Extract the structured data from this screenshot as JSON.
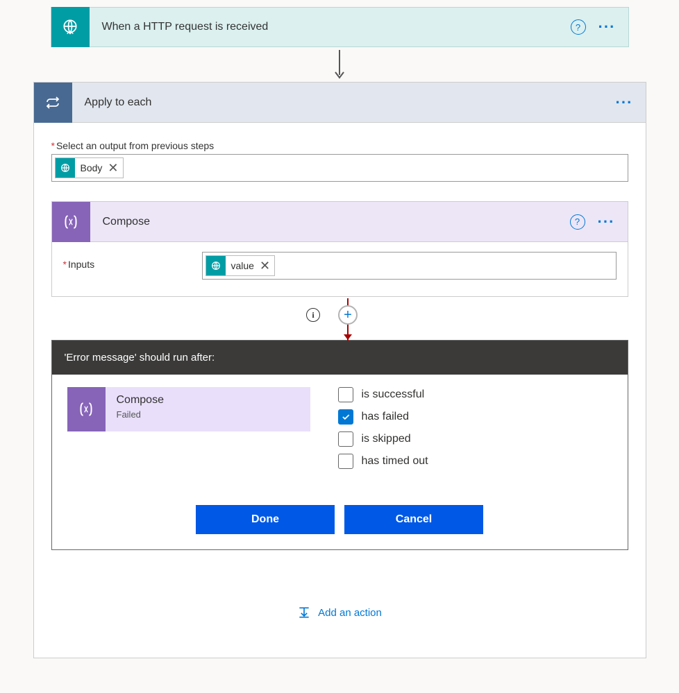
{
  "trigger": {
    "title": "When a HTTP request is received"
  },
  "loop": {
    "title": "Apply to each",
    "selectLabel": "Select an output from previous steps",
    "token": "Body"
  },
  "compose": {
    "title": "Compose",
    "inputsLabel": "Inputs",
    "token": "value"
  },
  "runAfter": {
    "header": "'Error message' should run after:",
    "prev": {
      "title": "Compose",
      "status": "Failed"
    },
    "options": {
      "success": "is successful",
      "failed": "has failed",
      "skipped": "is skipped",
      "timedout": "has timed out"
    },
    "buttons": {
      "done": "Done",
      "cancel": "Cancel"
    }
  },
  "addAction": "Add an action"
}
